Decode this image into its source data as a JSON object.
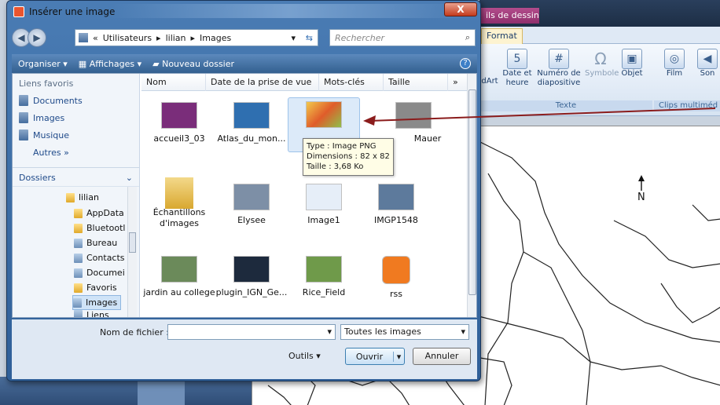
{
  "dialog": {
    "title": "Insérer une image",
    "close_label": "X",
    "address": {
      "prefix": "«",
      "crumbs": [
        "Utilisateurs",
        "lilian",
        "Images"
      ]
    },
    "search_placeholder": "Rechercher",
    "toolbar": {
      "organize": "Organiser",
      "views": "Affichages",
      "new_folder": "Nouveau dossier"
    },
    "nav": {
      "favorites_header": "Liens favoris",
      "favorites": [
        "Documents",
        "Images",
        "Musique"
      ],
      "more": "Autres »",
      "folders_header": "Dossiers",
      "tree_root": "lilian",
      "tree": [
        "AppData",
        "Bluetootl",
        "Bureau",
        "Contacts",
        "Documei",
        "Favoris",
        "Images",
        "Liens"
      ],
      "selected": "Images"
    },
    "columns": [
      "Nom",
      "Date de la prise de vue",
      "Mots-clés",
      "Taille"
    ],
    "files": [
      {
        "name": "accueil3_03",
        "color": "#7a2d7a"
      },
      {
        "name": "Atlas_du_mon...",
        "color": "#2f6fb0"
      },
      {
        "name": "",
        "color": "#e8a23b"
      },
      {
        "name": "Mauer",
        "color": "#8a8a8a"
      },
      {
        "name": "Échantillons d'images",
        "color": "#e7c860"
      },
      {
        "name": "Elysee",
        "color": "#7d8fa6"
      },
      {
        "name": "Image1",
        "color": "#e6eef8"
      },
      {
        "name": "IMGP1548",
        "color": "#5d7a9c"
      },
      {
        "name": "jardin au college",
        "color": "#6b8a5a"
      },
      {
        "name": "plugin_IGN_Ge...",
        "color": "#1d2a3d"
      },
      {
        "name": "Rice_Field",
        "color": "#6f9a4a"
      },
      {
        "name": "rss",
        "color": "#f07a20"
      }
    ],
    "tooltip": {
      "type": "Type : Image PNG",
      "dims": "Dimensions : 82 x 82",
      "size": "Taille : 3,68 Ko"
    },
    "bottom": {
      "filename_label": "Nom de fichier :",
      "filename_value": "",
      "filter": "Toutes les images",
      "tools": "Outils",
      "open": "Ouvrir",
      "cancel": "Annuler"
    }
  },
  "ppt": {
    "context_tab": "ils de dessin",
    "tab": "Format",
    "ribbon": [
      {
        "label": "dArt",
        "icon": "wordart-icon"
      },
      {
        "label": "Date et heure",
        "icon": "calendar-icon"
      },
      {
        "label": "Numéro de diapositive",
        "icon": "slide-number-icon"
      },
      {
        "label": "Symbole",
        "icon": "omega-icon"
      },
      {
        "label": "Objet",
        "icon": "object-icon"
      },
      {
        "label": "Film",
        "icon": "film-icon"
      },
      {
        "label": "Son",
        "icon": "sound-icon"
      }
    ],
    "groups": [
      "Texte",
      "Clips multiméd"
    ],
    "north": "N"
  }
}
